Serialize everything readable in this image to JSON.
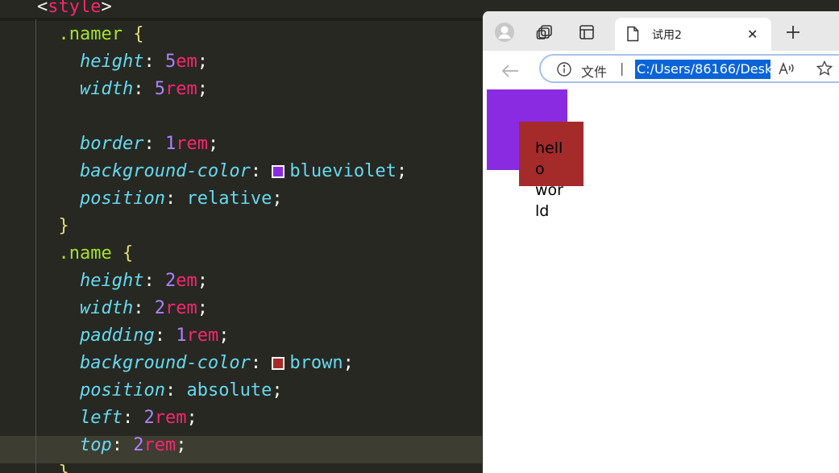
{
  "editor": {
    "lines": [
      {
        "parts": [
          {
            "t": "<",
            "c": "punc"
          },
          {
            "t": "style",
            "c": "tag"
          },
          {
            "t": ">",
            "c": "punc"
          }
        ]
      },
      {
        "parts": [
          {
            "t": "  .namer ",
            "c": "sel"
          },
          {
            "t": "{",
            "c": "brace"
          }
        ]
      },
      {
        "parts": [
          {
            "t": "    height",
            "c": "prop"
          },
          {
            "t": ": ",
            "c": "punc"
          },
          {
            "t": "5",
            "c": "num"
          },
          {
            "t": "em",
            "c": "unit"
          },
          {
            "t": ";",
            "c": "punc"
          }
        ]
      },
      {
        "parts": [
          {
            "t": "    width",
            "c": "prop"
          },
          {
            "t": ": ",
            "c": "punc"
          },
          {
            "t": "5",
            "c": "num"
          },
          {
            "t": "rem",
            "c": "unit"
          },
          {
            "t": ";",
            "c": "punc"
          }
        ]
      },
      {
        "parts": []
      },
      {
        "parts": [
          {
            "t": "    border",
            "c": "prop"
          },
          {
            "t": ": ",
            "c": "punc"
          },
          {
            "t": "1",
            "c": "num"
          },
          {
            "t": "rem",
            "c": "unit"
          },
          {
            "t": ";",
            "c": "punc"
          }
        ]
      },
      {
        "parts": [
          {
            "t": "    background-color",
            "c": "prop"
          },
          {
            "t": ": ",
            "c": "punc"
          },
          {
            "swatch": "#8a2be2"
          },
          {
            "t": "blueviolet",
            "c": "kw"
          },
          {
            "t": ";",
            "c": "punc"
          }
        ]
      },
      {
        "parts": [
          {
            "t": "    position",
            "c": "prop"
          },
          {
            "t": ": ",
            "c": "punc"
          },
          {
            "t": "relative",
            "c": "kw"
          },
          {
            "t": ";",
            "c": "punc"
          }
        ]
      },
      {
        "parts": [
          {
            "t": "  }",
            "c": "brace"
          }
        ]
      },
      {
        "parts": [
          {
            "t": "  .name ",
            "c": "sel"
          },
          {
            "t": "{",
            "c": "brace"
          }
        ]
      },
      {
        "parts": [
          {
            "t": "    height",
            "c": "prop"
          },
          {
            "t": ": ",
            "c": "punc"
          },
          {
            "t": "2",
            "c": "num"
          },
          {
            "t": "em",
            "c": "unit"
          },
          {
            "t": ";",
            "c": "punc"
          }
        ]
      },
      {
        "parts": [
          {
            "t": "    width",
            "c": "prop"
          },
          {
            "t": ": ",
            "c": "punc"
          },
          {
            "t": "2",
            "c": "num"
          },
          {
            "t": "rem",
            "c": "unit"
          },
          {
            "t": ";",
            "c": "punc"
          }
        ]
      },
      {
        "parts": [
          {
            "t": "    padding",
            "c": "prop"
          },
          {
            "t": ": ",
            "c": "punc"
          },
          {
            "t": "1",
            "c": "num"
          },
          {
            "t": "rem",
            "c": "unit"
          },
          {
            "t": ";",
            "c": "punc"
          }
        ]
      },
      {
        "parts": [
          {
            "t": "    background-color",
            "c": "prop"
          },
          {
            "t": ": ",
            "c": "punc"
          },
          {
            "swatch": "#a52a2a"
          },
          {
            "t": "brown",
            "c": "kw"
          },
          {
            "t": ";",
            "c": "punc"
          }
        ]
      },
      {
        "parts": [
          {
            "t": "    position",
            "c": "prop"
          },
          {
            "t": ": ",
            "c": "punc"
          },
          {
            "t": "absolute",
            "c": "kw"
          },
          {
            "t": ";",
            "c": "punc"
          }
        ]
      },
      {
        "parts": [
          {
            "t": "    left",
            "c": "prop"
          },
          {
            "t": ": ",
            "c": "punc"
          },
          {
            "t": "2",
            "c": "num"
          },
          {
            "t": "rem",
            "c": "unit"
          },
          {
            "t": ";",
            "c": "punc"
          }
        ]
      },
      {
        "parts": [
          {
            "t": "    top",
            "c": "prop"
          },
          {
            "t": ": ",
            "c": "punc"
          },
          {
            "t": "2",
            "c": "num"
          },
          {
            "t": "rem",
            "c": "unit"
          },
          {
            "t": ";",
            "c": "punc"
          }
        ]
      },
      {
        "parts": [
          {
            "t": "  }",
            "c": "brace"
          }
        ]
      }
    ]
  },
  "browser": {
    "tab_title": "试用2",
    "tab_close": "✕",
    "address": {
      "file_label": "文件",
      "separator": "|",
      "url": "C:/Users/86166/Desk",
      "read_aloud": "Ă′"
    },
    "page": {
      "box_text": "hello world"
    },
    "colors": {
      "namer": "#8a2be2",
      "name": "#a52a2a",
      "selection": "#0a64d8"
    }
  }
}
